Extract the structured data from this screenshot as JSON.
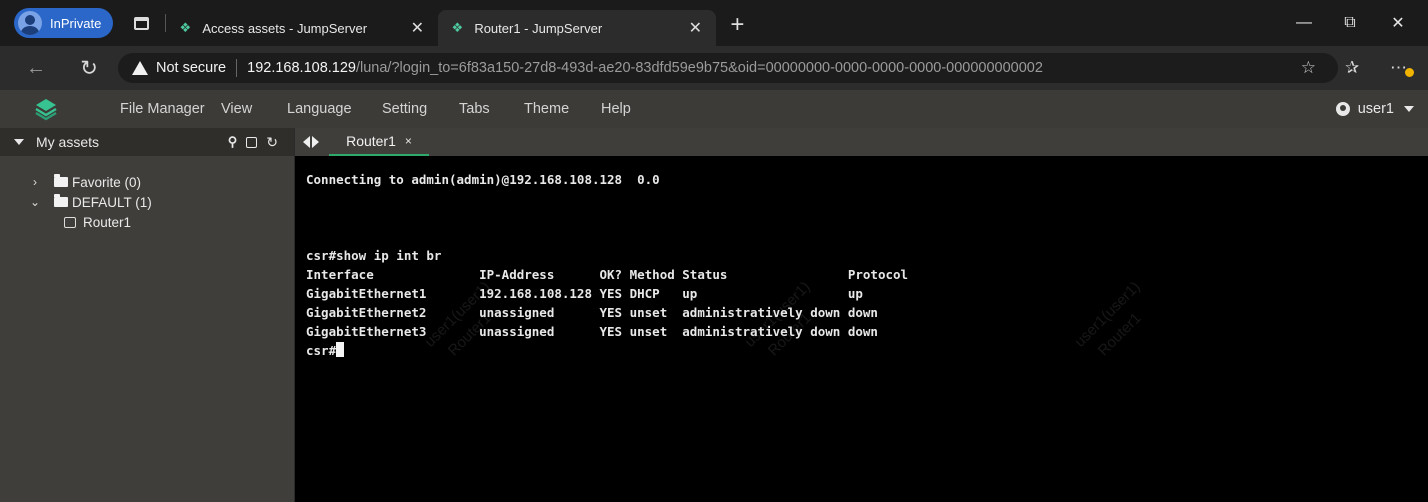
{
  "browser": {
    "inprivate_label": "InPrivate",
    "tabs": [
      {
        "title": "Access assets - JumpServer",
        "favicon": "jumpserver-icon",
        "active": false
      },
      {
        "title": "Router1 - JumpServer",
        "favicon": "jumpserver-icon",
        "active": true
      }
    ],
    "not_secure_label": "Not secure",
    "url_host": "192.168.108.129",
    "url_path": "/luna/?login_to=6f83a150-27d8-493d-ae20-83dfd59e9b75&oid=00000000-0000-0000-0000-000000000002"
  },
  "menu": {
    "items": [
      "File Manager",
      "View",
      "Language",
      "Setting",
      "Tabs",
      "Theme",
      "Help"
    ],
    "user": "user1"
  },
  "sidebar": {
    "title": "My assets",
    "tree": [
      {
        "label": "Favorite (0)",
        "expanded": false
      },
      {
        "label": "DEFAULT (1)",
        "expanded": true
      },
      {
        "label": "Router1",
        "type": "host"
      }
    ]
  },
  "session": {
    "tab_label": "Router1",
    "tab_close": "×"
  },
  "terminal": {
    "lines": [
      "Connecting to admin(admin)@192.168.108.128  0.0",
      "",
      "",
      "",
      "csr#show ip int br",
      "Interface              IP-Address      OK? Method Status                Protocol",
      "GigabitEthernet1       192.168.108.128 YES DHCP   up                    up",
      "GigabitEthernet2       unassigned      YES unset  administratively down down",
      "GigabitEthernet3       unassigned      YES unset  administratively down down"
    ],
    "prompt": "csr#",
    "watermark_user": "user1(user1)",
    "watermark_asset": "Router1"
  },
  "colors": {
    "accent_green": "#2fa86b",
    "inprivate_blue": "#2a67c8",
    "menu_bg": "#3c3b37",
    "terminal_bg": "#000000"
  }
}
